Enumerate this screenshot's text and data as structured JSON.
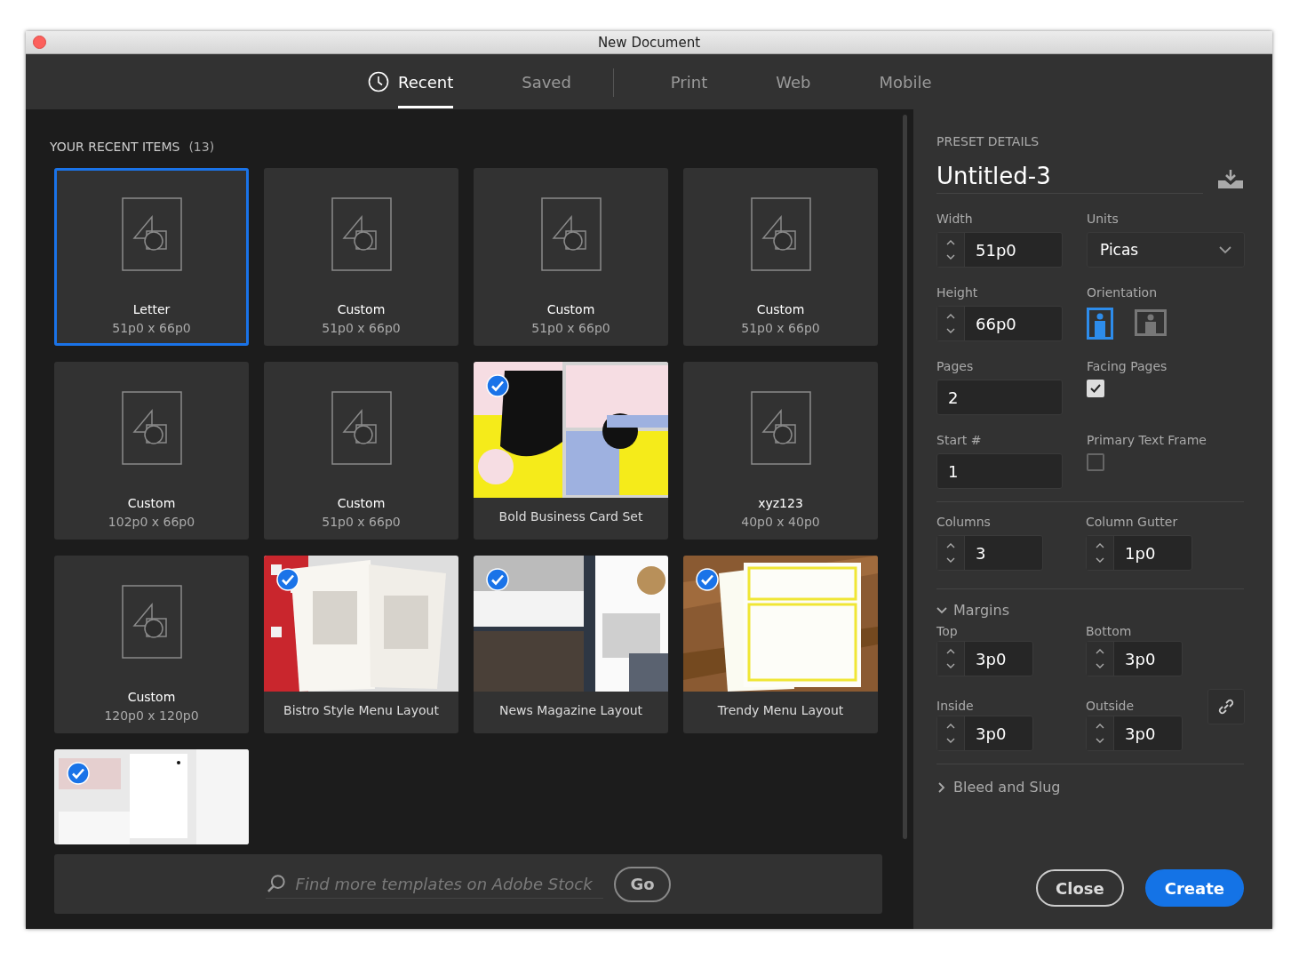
{
  "window": {
    "title": "New Document"
  },
  "tabs": [
    {
      "label": "Recent",
      "selected": true,
      "divider_after": false
    },
    {
      "label": "Saved",
      "selected": false,
      "divider_after": true
    },
    {
      "label": "Print",
      "selected": false,
      "divider_after": false
    },
    {
      "label": "Web",
      "selected": false,
      "divider_after": false
    },
    {
      "label": "Mobile",
      "selected": false,
      "divider_after": false
    }
  ],
  "recent": {
    "heading": "YOUR RECENT ITEMS",
    "count": "(13)",
    "items": [
      {
        "kind": "blank",
        "name": "Letter",
        "size": "51p0 x 66p0",
        "selected": true
      },
      {
        "kind": "blank",
        "name": "Custom",
        "size": "51p0 x 66p0",
        "selected": false
      },
      {
        "kind": "blank",
        "name": "Custom",
        "size": "51p0 x 66p0",
        "selected": false
      },
      {
        "kind": "blank",
        "name": "Custom",
        "size": "51p0 x 66p0",
        "selected": false
      },
      {
        "kind": "blank",
        "name": "Custom",
        "size": "102p0 x 66p0",
        "selected": false
      },
      {
        "kind": "blank",
        "name": "Custom",
        "size": "51p0 x 66p0",
        "selected": false
      },
      {
        "kind": "template",
        "name": "Bold Business Card Set",
        "checked": true,
        "selected": false
      },
      {
        "kind": "blank",
        "name": "xyz123",
        "size": "40p0 x 40p0",
        "selected": false
      },
      {
        "kind": "blank",
        "name": "Custom",
        "size": "120p0 x 120p0",
        "selected": false
      },
      {
        "kind": "template",
        "name": "Bistro Style Menu Layout",
        "checked": true,
        "selected": false
      },
      {
        "kind": "template",
        "name": "News Magazine Layout",
        "checked": true,
        "selected": false
      },
      {
        "kind": "template",
        "name": "Trendy Menu Layout",
        "checked": true,
        "selected": false
      },
      {
        "kind": "template",
        "checked": true,
        "selected": false
      }
    ]
  },
  "search": {
    "placeholder": "Find more templates on Adobe Stock",
    "button": "Go"
  },
  "preset": {
    "heading": "PRESET DETAILS",
    "name": "Untitled-3",
    "width": {
      "label": "Width",
      "value": "51p0"
    },
    "units": {
      "label": "Units",
      "value": "Picas"
    },
    "height": {
      "label": "Height",
      "value": "66p0"
    },
    "orientation": {
      "label": "Orientation",
      "options": [
        {
          "kind": "portrait",
          "selected": true
        },
        {
          "kind": "landscape",
          "selected": false
        }
      ]
    },
    "pages": {
      "label": "Pages",
      "value": "2"
    },
    "facing_pages": {
      "label": "Facing Pages",
      "checked": true
    },
    "start": {
      "label": "Start #",
      "value": "1"
    },
    "primary_text_frame": {
      "label": "Primary Text Frame",
      "checked": false
    },
    "columns": {
      "label": "Columns",
      "value": "3"
    },
    "column_gutter": {
      "label": "Column Gutter",
      "value": "1p0"
    },
    "margins": {
      "label": "Margins",
      "expanded": true,
      "fields": [
        {
          "label": "Top",
          "value": "3p0"
        },
        {
          "label": "Bottom",
          "value": "3p0"
        },
        {
          "label": "Inside",
          "value": "3p0"
        },
        {
          "label": "Outside",
          "value": "3p0"
        }
      ]
    },
    "bleed_and_slug": {
      "label": "Bleed and Slug",
      "expanded": false
    }
  },
  "buttons": [
    {
      "label": "Close",
      "kind": "secondary"
    },
    {
      "label": "Create",
      "kind": "primary"
    }
  ]
}
